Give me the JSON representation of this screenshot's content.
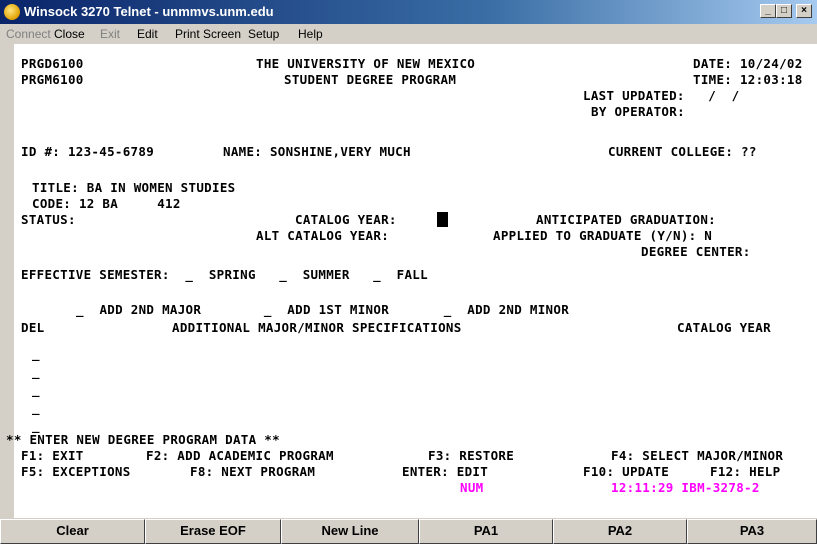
{
  "window": {
    "title": "Winsock 3270 Telnet - unmmvs.unm.edu",
    "buttons": {
      "minimize": "_",
      "maximize": "□",
      "close": "×"
    }
  },
  "menu": {
    "connect": "Connect",
    "close": "Close",
    "exit": "Exit",
    "edit": "Edit",
    "print_screen": "Print Screen",
    "setup": "Setup",
    "help": "Help"
  },
  "screen": {
    "prog1": "PRGD6100",
    "prog2": "PRGM6100",
    "org": "THE UNIVERSITY OF NEW MEXICO",
    "subtitle": "STUDENT DEGREE PROGRAM",
    "date": "DATE: 10/24/02",
    "time": "TIME: 12:03:18",
    "last_updated": "LAST UPDATED:   /  /",
    "by_operator": "BY OPERATOR:",
    "id": "ID #: 123-45-6789",
    "name": "NAME: SONSHINE,VERY MUCH",
    "current_college": "CURRENT COLLEGE: ??",
    "title_line": "TITLE: BA IN WOMEN STUDIES",
    "code_line": "CODE: 12 BA     412",
    "status": "STATUS:",
    "catalog_year": "CATALOG YEAR:",
    "anticipated": "ANTICIPATED GRADUATION:",
    "alt_catalog_year": "ALT CATALOG YEAR:",
    "applied": "APPLIED TO GRADUATE (Y/N): N",
    "degree_center": "DEGREE CENTER:",
    "effective": "EFFECTIVE SEMESTER:  _  SPRING   _  SUMMER   _  FALL",
    "add_line": "_  ADD 2ND MAJOR        _  ADD 1ST MINOR       _  ADD 2ND MINOR",
    "del": "DEL",
    "additional": "ADDITIONAL MAJOR/MINOR SPECIFICATIONS",
    "catalog_year_col": "CATALOG YEAR",
    "blanks": [
      "_",
      "_",
      "_",
      "_",
      "_"
    ],
    "enter_msg": "** ENTER NEW DEGREE PROGRAM DATA **",
    "f1": "F1: EXIT",
    "f2": "F2: ADD ACADEMIC PROGRAM",
    "f3": "F3: RESTORE",
    "f4": "F4: SELECT MAJOR/MINOR",
    "f5": "F5: EXCEPTIONS",
    "f8": "F8: NEXT PROGRAM",
    "enter_edit": "ENTER: EDIT",
    "f10": "F10: UPDATE",
    "f12": "F12: HELP",
    "num": "NUM",
    "clock": "12:11:29 IBM-3278-2"
  },
  "bottom_buttons": [
    "Clear",
    "Erase EOF",
    "New Line",
    "PA1",
    "PA2",
    "PA3"
  ],
  "colors": {
    "title_start": "#0a246a",
    "title_end": "#a6caf0",
    "status_magenta": "#ff00ff",
    "chrome": "#d4d0c8"
  }
}
